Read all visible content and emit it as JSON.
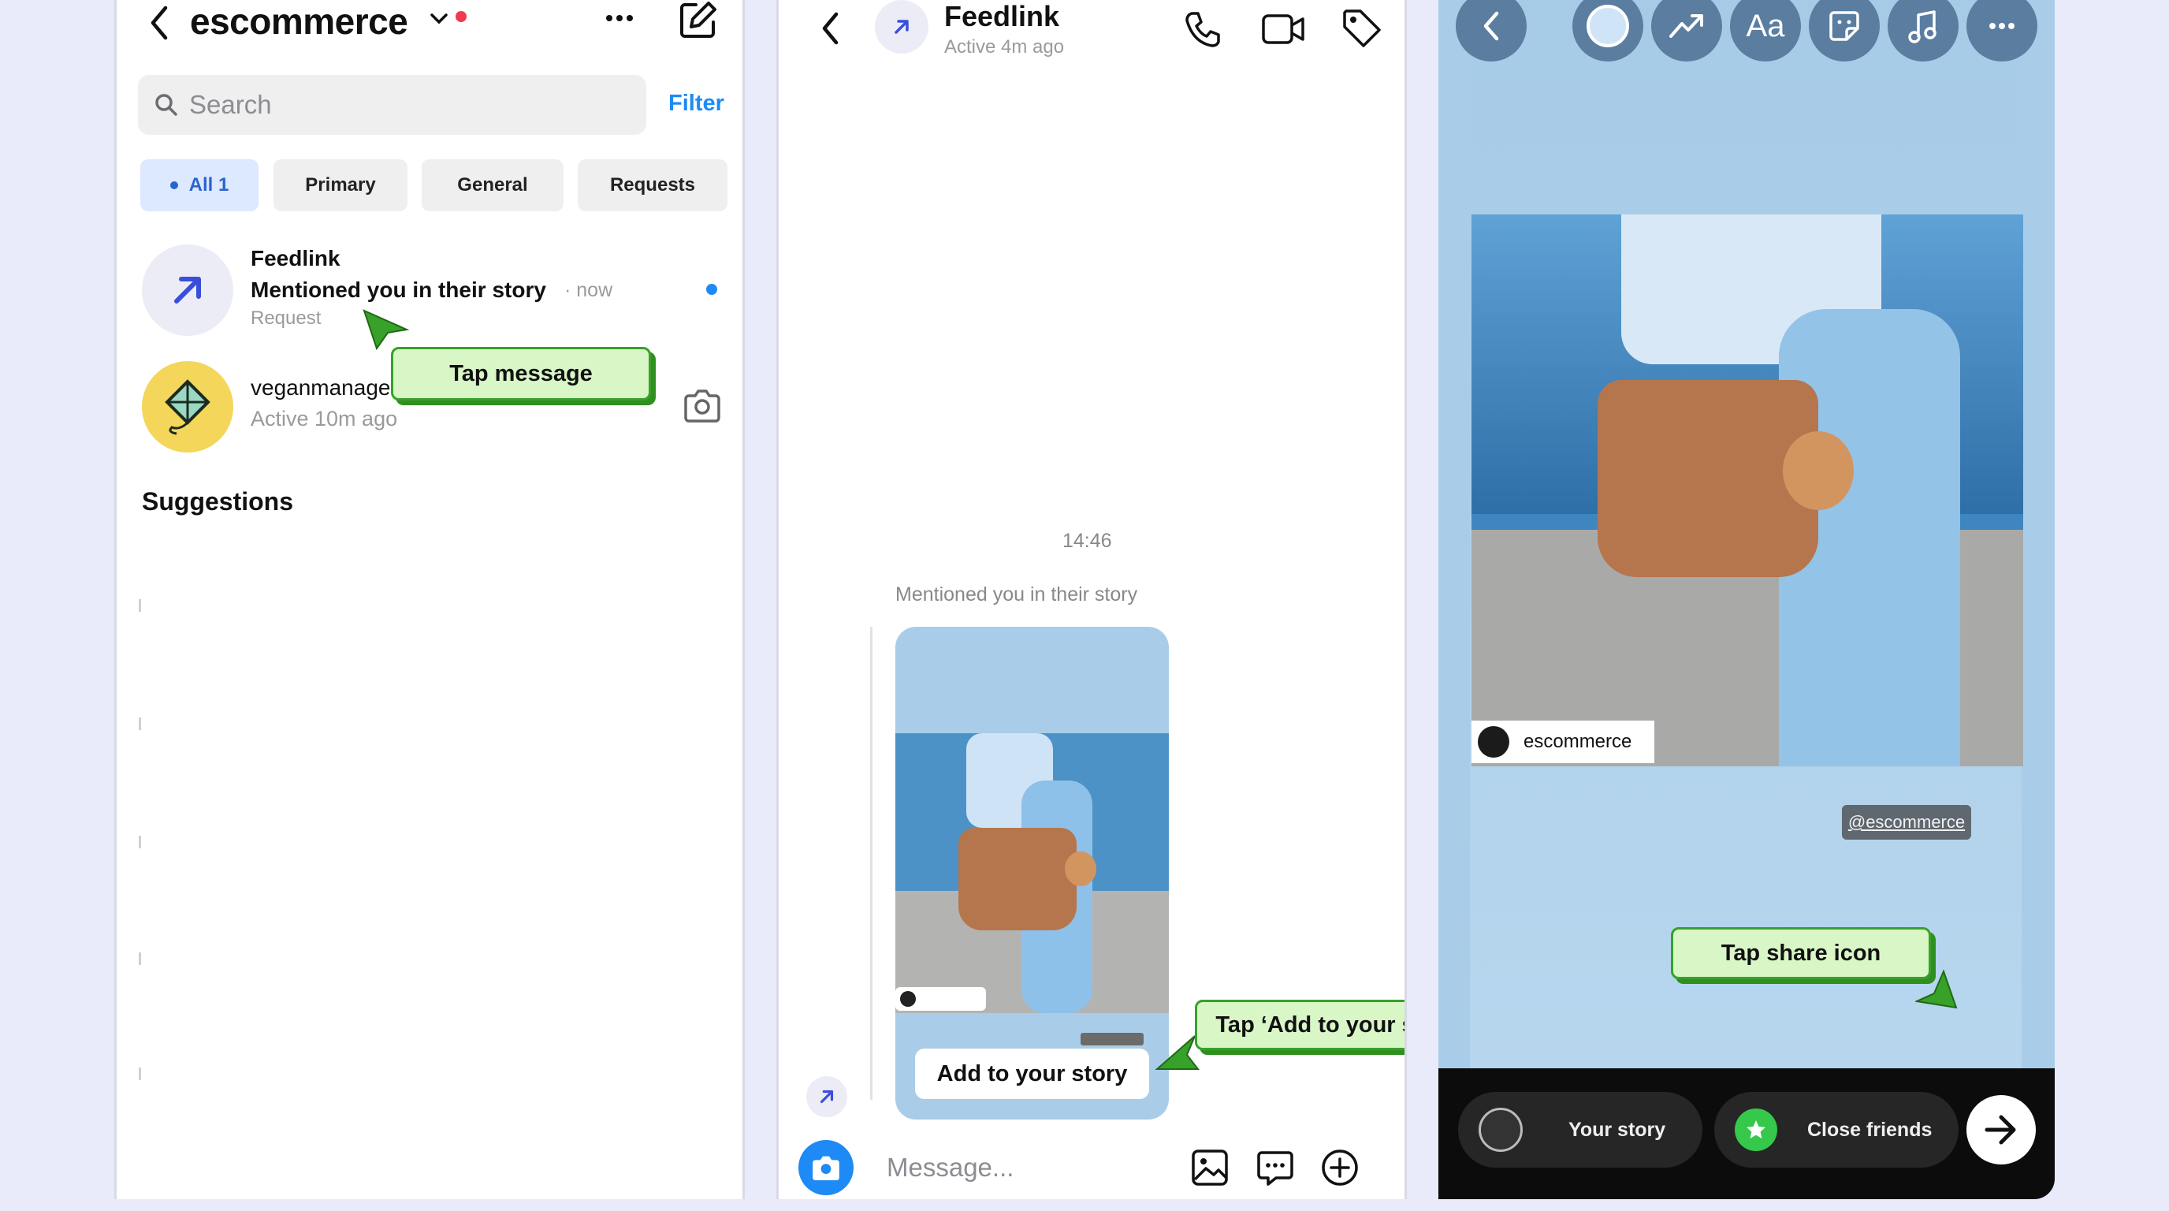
{
  "panel1": {
    "title": "escommerce",
    "search_placeholder": "Search",
    "filter_label": "Filter",
    "chips": [
      "All 1",
      "Primary",
      "General",
      "Requests"
    ],
    "conversations": [
      {
        "name": "Feedlink",
        "message": "Mentioned you in their story",
        "time": "· now",
        "label": "Request"
      },
      {
        "name": "veganmanage",
        "status": "Active 10m ago"
      }
    ],
    "suggestions_heading": "Suggestions",
    "callout": "Tap message"
  },
  "panel2": {
    "contact_name": "Feedlink",
    "contact_status": "Active 4m ago",
    "timestamp": "14:46",
    "mention_text": "Mentioned you in their story",
    "add_to_story_label": "Add to your story",
    "message_placeholder": "Message...",
    "callout": "Tap ‘Add to your story’"
  },
  "panel3": {
    "text_tool_label": "Aa",
    "account_tag": "escommerce",
    "mention_sticker": "@escommerce",
    "callout": "Tap share icon",
    "your_story_label": "Your story",
    "close_friends_label": "Close friends"
  },
  "colors": {
    "accent_blue": "#1d8af6",
    "callout_bg": "#d9f6c7",
    "callout_border": "#38a12a",
    "close_friends_green": "#35c84a"
  }
}
